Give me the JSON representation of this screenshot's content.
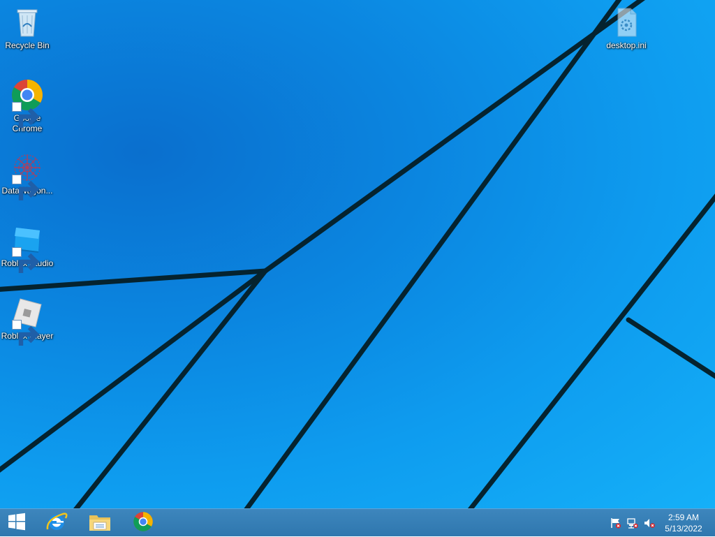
{
  "desktop": {
    "icons": [
      {
        "label": "Recycle Bin",
        "icon": "recycle-bin-icon"
      },
      {
        "label": "Google\nChrome",
        "icon": "chrome-icon"
      },
      {
        "label": "DataWagon...",
        "icon": "datawagon-icon"
      },
      {
        "label": "Roblox Studio",
        "icon": "roblox-studio-icon"
      },
      {
        "label": "Roblox Player",
        "icon": "roblox-player-icon"
      },
      {
        "label": "desktop.ini",
        "icon": "ini-file-icon"
      }
    ]
  },
  "taskbar": {
    "pinned": [
      {
        "icon": "windows-start-icon"
      },
      {
        "icon": "internet-explorer-icon"
      },
      {
        "icon": "file-explorer-icon"
      },
      {
        "icon": "chrome-icon"
      }
    ],
    "tray": [
      {
        "icon": "action-center-flag-icon"
      },
      {
        "icon": "network-icon"
      },
      {
        "icon": "volume-muted-icon"
      }
    ],
    "clock": {
      "time": "2:59 AM",
      "date": "5/13/2022"
    }
  },
  "colors": {
    "desktop_bg": "#0e9cef",
    "taskbar_bg": "#3580b7",
    "wallpaper_line": "#062a38"
  }
}
